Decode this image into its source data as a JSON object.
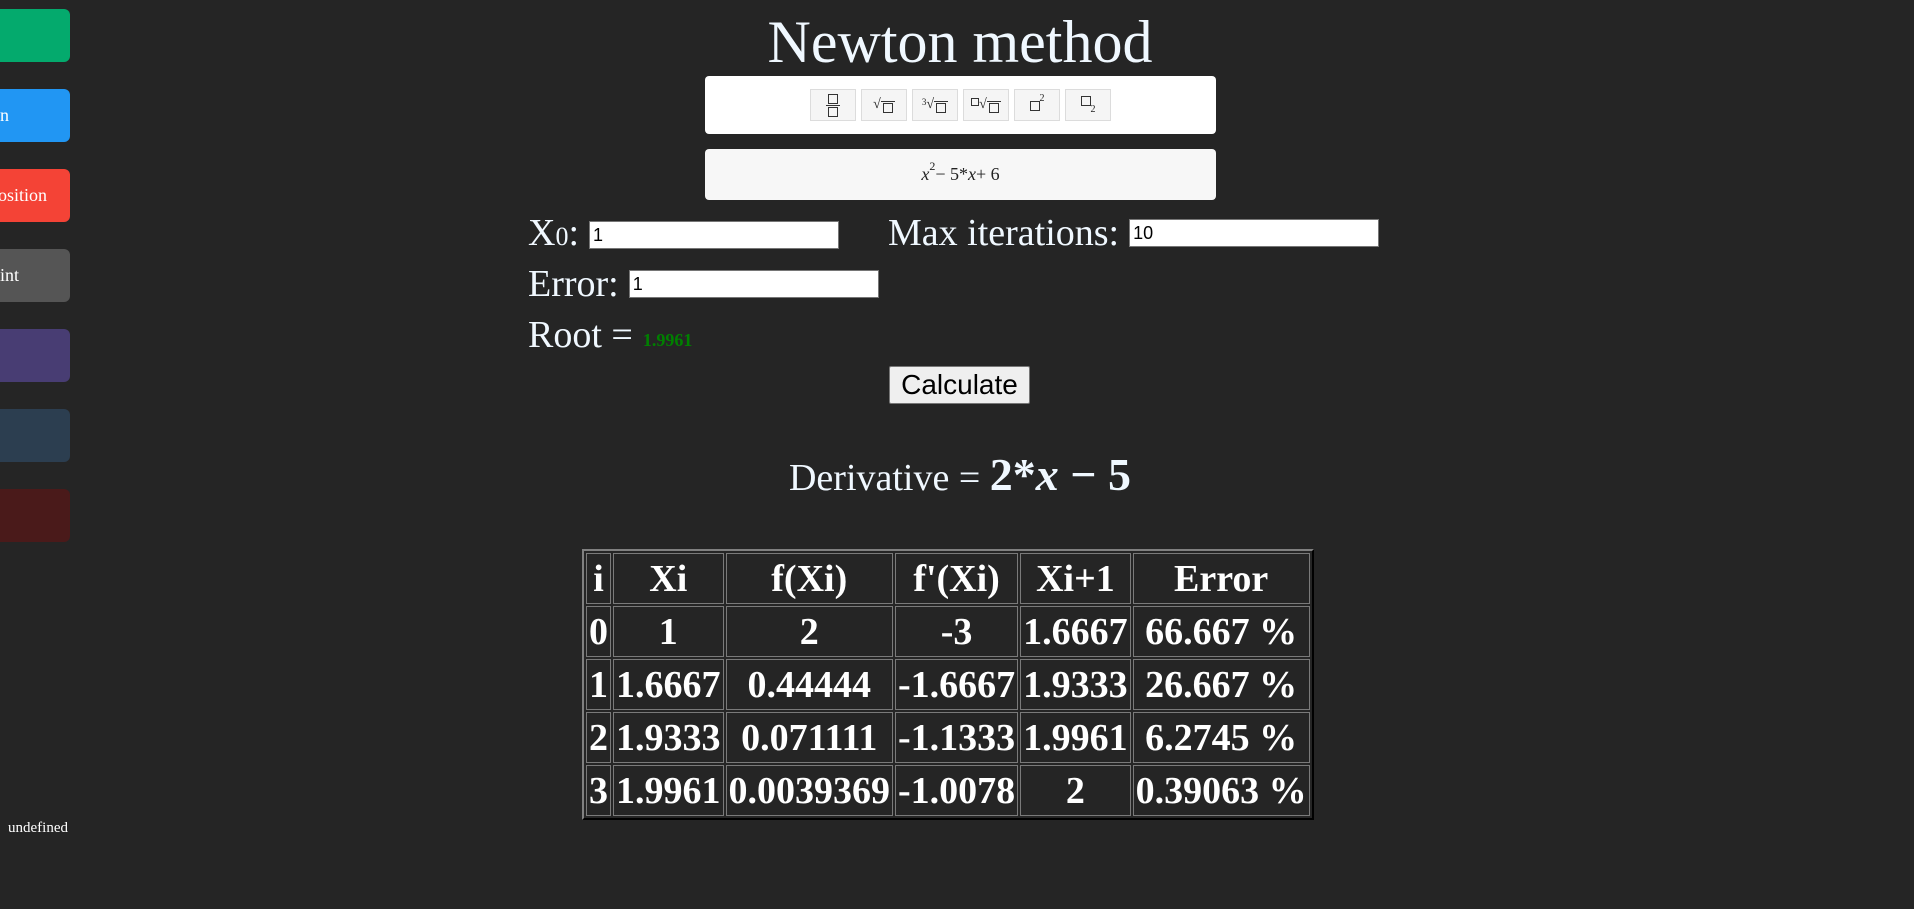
{
  "sidebar": {
    "items": [
      {
        "label": "",
        "color": "#04aa6d"
      },
      {
        "label": "n",
        "color": "#2196f3"
      },
      {
        "label": "osition",
        "color": "#f44336"
      },
      {
        "label": "int",
        "color": "#555555"
      },
      {
        "label": "",
        "color": "#483d73"
      },
      {
        "label": "",
        "color": "#2c3e50"
      },
      {
        "label": "",
        "color": "#4a1a1a"
      }
    ],
    "footer_text": "undefined"
  },
  "title": "Newton method",
  "toolbar": {
    "buttons": [
      "fraction-icon",
      "sqrt-icon",
      "cube-root-icon",
      "nth-root-icon",
      "superscript-icon",
      "subscript-icon"
    ],
    "cube_index": "3",
    "power": "2",
    "sub": "2"
  },
  "expression": {
    "x": "x",
    "exp": "2",
    "rest": " − 5*",
    "x2": "x",
    "tail": " + 6"
  },
  "inputs": {
    "x0_label": "X",
    "x0_sub": "0",
    "x0_colon": ":",
    "x0_value": "1",
    "max_iter_label": "Max iterations:",
    "max_iter_value": "10",
    "error_label": "Error:",
    "error_value": "1"
  },
  "root": {
    "label": "Root =",
    "value": "1.9961",
    "color": "#008000"
  },
  "calculate_label": "Calculate",
  "derivative": {
    "label": "Derivative = ",
    "expr_a": "2*",
    "expr_x": "x",
    "expr_b": " − 5"
  },
  "table": {
    "headers": [
      "i",
      "Xi",
      "f(Xi)",
      "f'(Xi)",
      "Xi+1",
      "Error"
    ],
    "rows": [
      [
        "0",
        "1",
        "2",
        "-3",
        "1.6667",
        "66.667 %"
      ],
      [
        "1",
        "1.6667",
        "0.44444",
        "-1.6667",
        "1.9333",
        "26.667 %"
      ],
      [
        "2",
        "1.9333",
        "0.071111",
        "-1.1333",
        "1.9961",
        "6.2745 %"
      ],
      [
        "3",
        "1.9961",
        "0.0039369",
        "-1.0078",
        "2",
        "0.39063 %"
      ]
    ]
  }
}
